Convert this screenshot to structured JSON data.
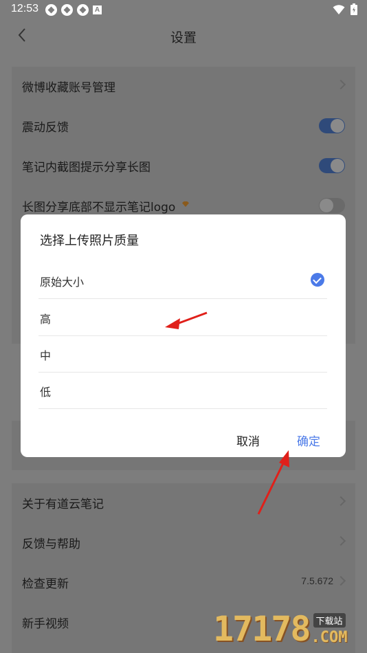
{
  "status": {
    "time": "12:53"
  },
  "header": {
    "title": "设置"
  },
  "settings": {
    "weibo_label": "微博收藏账号管理",
    "vibration_label": "震动反馈",
    "screenshot_share_label": "笔记内截图提示分享长图",
    "hide_logo_label": "长图分享底部不显示笔记logo"
  },
  "about": {
    "about_label": "关于有道云笔记",
    "feedback_label": "反馈与帮助",
    "update_label": "检查更新",
    "version": "7.5.672",
    "video_label": "新手视频"
  },
  "dialog": {
    "title": "选择上传照片质量",
    "options": [
      "原始大小",
      "高",
      "中",
      "低"
    ],
    "selected": "原始大小",
    "cancel_label": "取消",
    "confirm_label": "确定"
  },
  "watermark": {
    "number": "17178",
    "tag": "下载站",
    "domain": ".COM"
  },
  "colors": {
    "accent": "#4b7ae8",
    "arrow": "#e0201a"
  }
}
